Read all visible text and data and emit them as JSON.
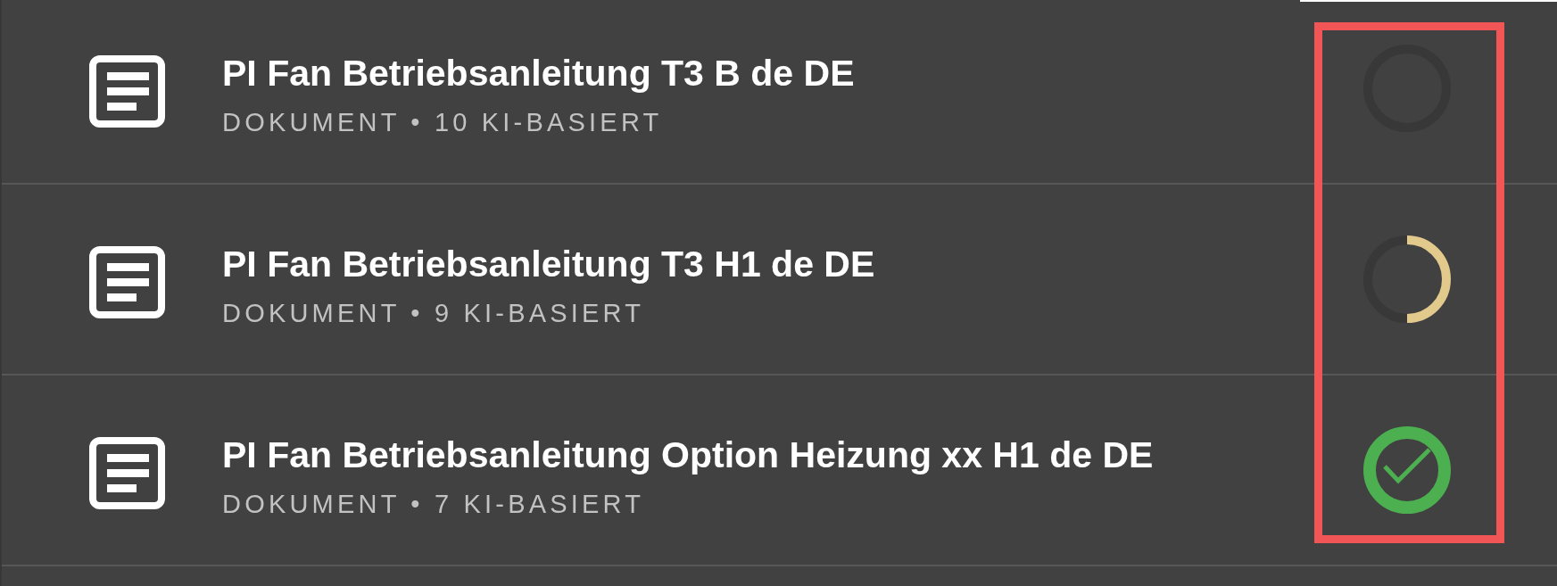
{
  "list": {
    "status_highlighted": true,
    "items": [
      {
        "title": "PI Fan Betriebsanleitung T3 B de DE",
        "subtitle": "DOKUMENT • 10 KI-BASIERT",
        "status": {
          "kind": "waiting"
        }
      },
      {
        "title": "PI Fan Betriebsanleitung T3 H1 de DE",
        "subtitle": "DOKUMENT • 9 KI-BASIERT",
        "status": {
          "kind": "progress",
          "level": 0.5
        }
      },
      {
        "title": "PI Fan Betriebsanleitung Option Heizung xx H1 de DE",
        "subtitle": "DOKUMENT • 7 KI-BASIERT",
        "status": {
          "kind": "done"
        }
      }
    ]
  }
}
